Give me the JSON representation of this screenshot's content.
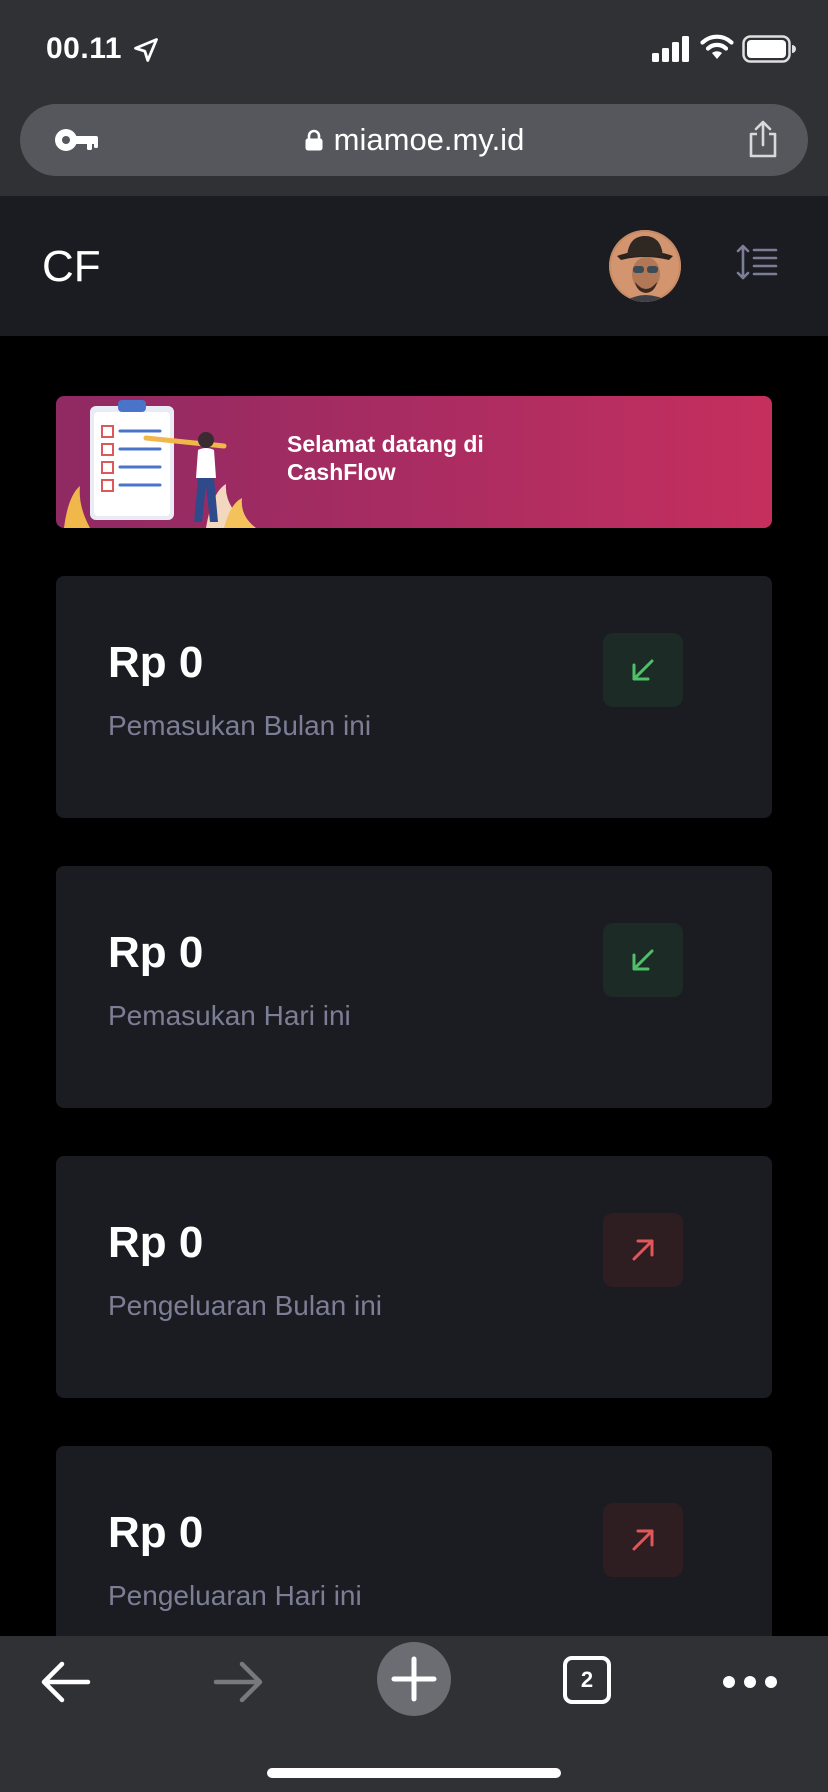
{
  "status_bar": {
    "time": "00.11",
    "icons": [
      "location-arrow-icon",
      "signal-icon",
      "wifi-icon",
      "battery-icon"
    ]
  },
  "browser": {
    "url": "miamoe.my.id",
    "icons": [
      "key-icon",
      "lock-icon",
      "share-icon"
    ],
    "toolbar": {
      "tab_count": "2",
      "icons": [
        "back-arrow-icon",
        "forward-arrow-icon",
        "plus-icon",
        "tabs-icon",
        "more-icon"
      ]
    }
  },
  "header": {
    "brand": "CF",
    "icons": [
      "avatar",
      "sort-menu-icon"
    ]
  },
  "banner": {
    "text": "Selamat datang di CashFlow"
  },
  "cards": [
    {
      "amount": "Rp 0",
      "label": "Pemasukan Bulan ini",
      "icon": "arrow-down-left-icon",
      "color": "#4fbf6a"
    },
    {
      "amount": "Rp 0",
      "label": "Pemasukan Hari ini",
      "icon": "arrow-down-left-icon",
      "color": "#4fbf6a"
    },
    {
      "amount": "Rp 0",
      "label": "Pengeluaran Bulan ini",
      "icon": "arrow-up-right-icon",
      "color": "#e0575a"
    },
    {
      "amount": "Rp 0",
      "label": "Pengeluaran Hari ini",
      "icon": "arrow-up-right-icon",
      "color": "#e0575a"
    }
  ],
  "colors": {
    "chrome": "#303135",
    "panel": "#1a1c22",
    "background": "#000000",
    "muted_text": "#7c7e95",
    "banner_start": "#8f2a63",
    "banner_end": "#c52f5e",
    "income": "#4fbf6a",
    "expense": "#e0575a"
  }
}
